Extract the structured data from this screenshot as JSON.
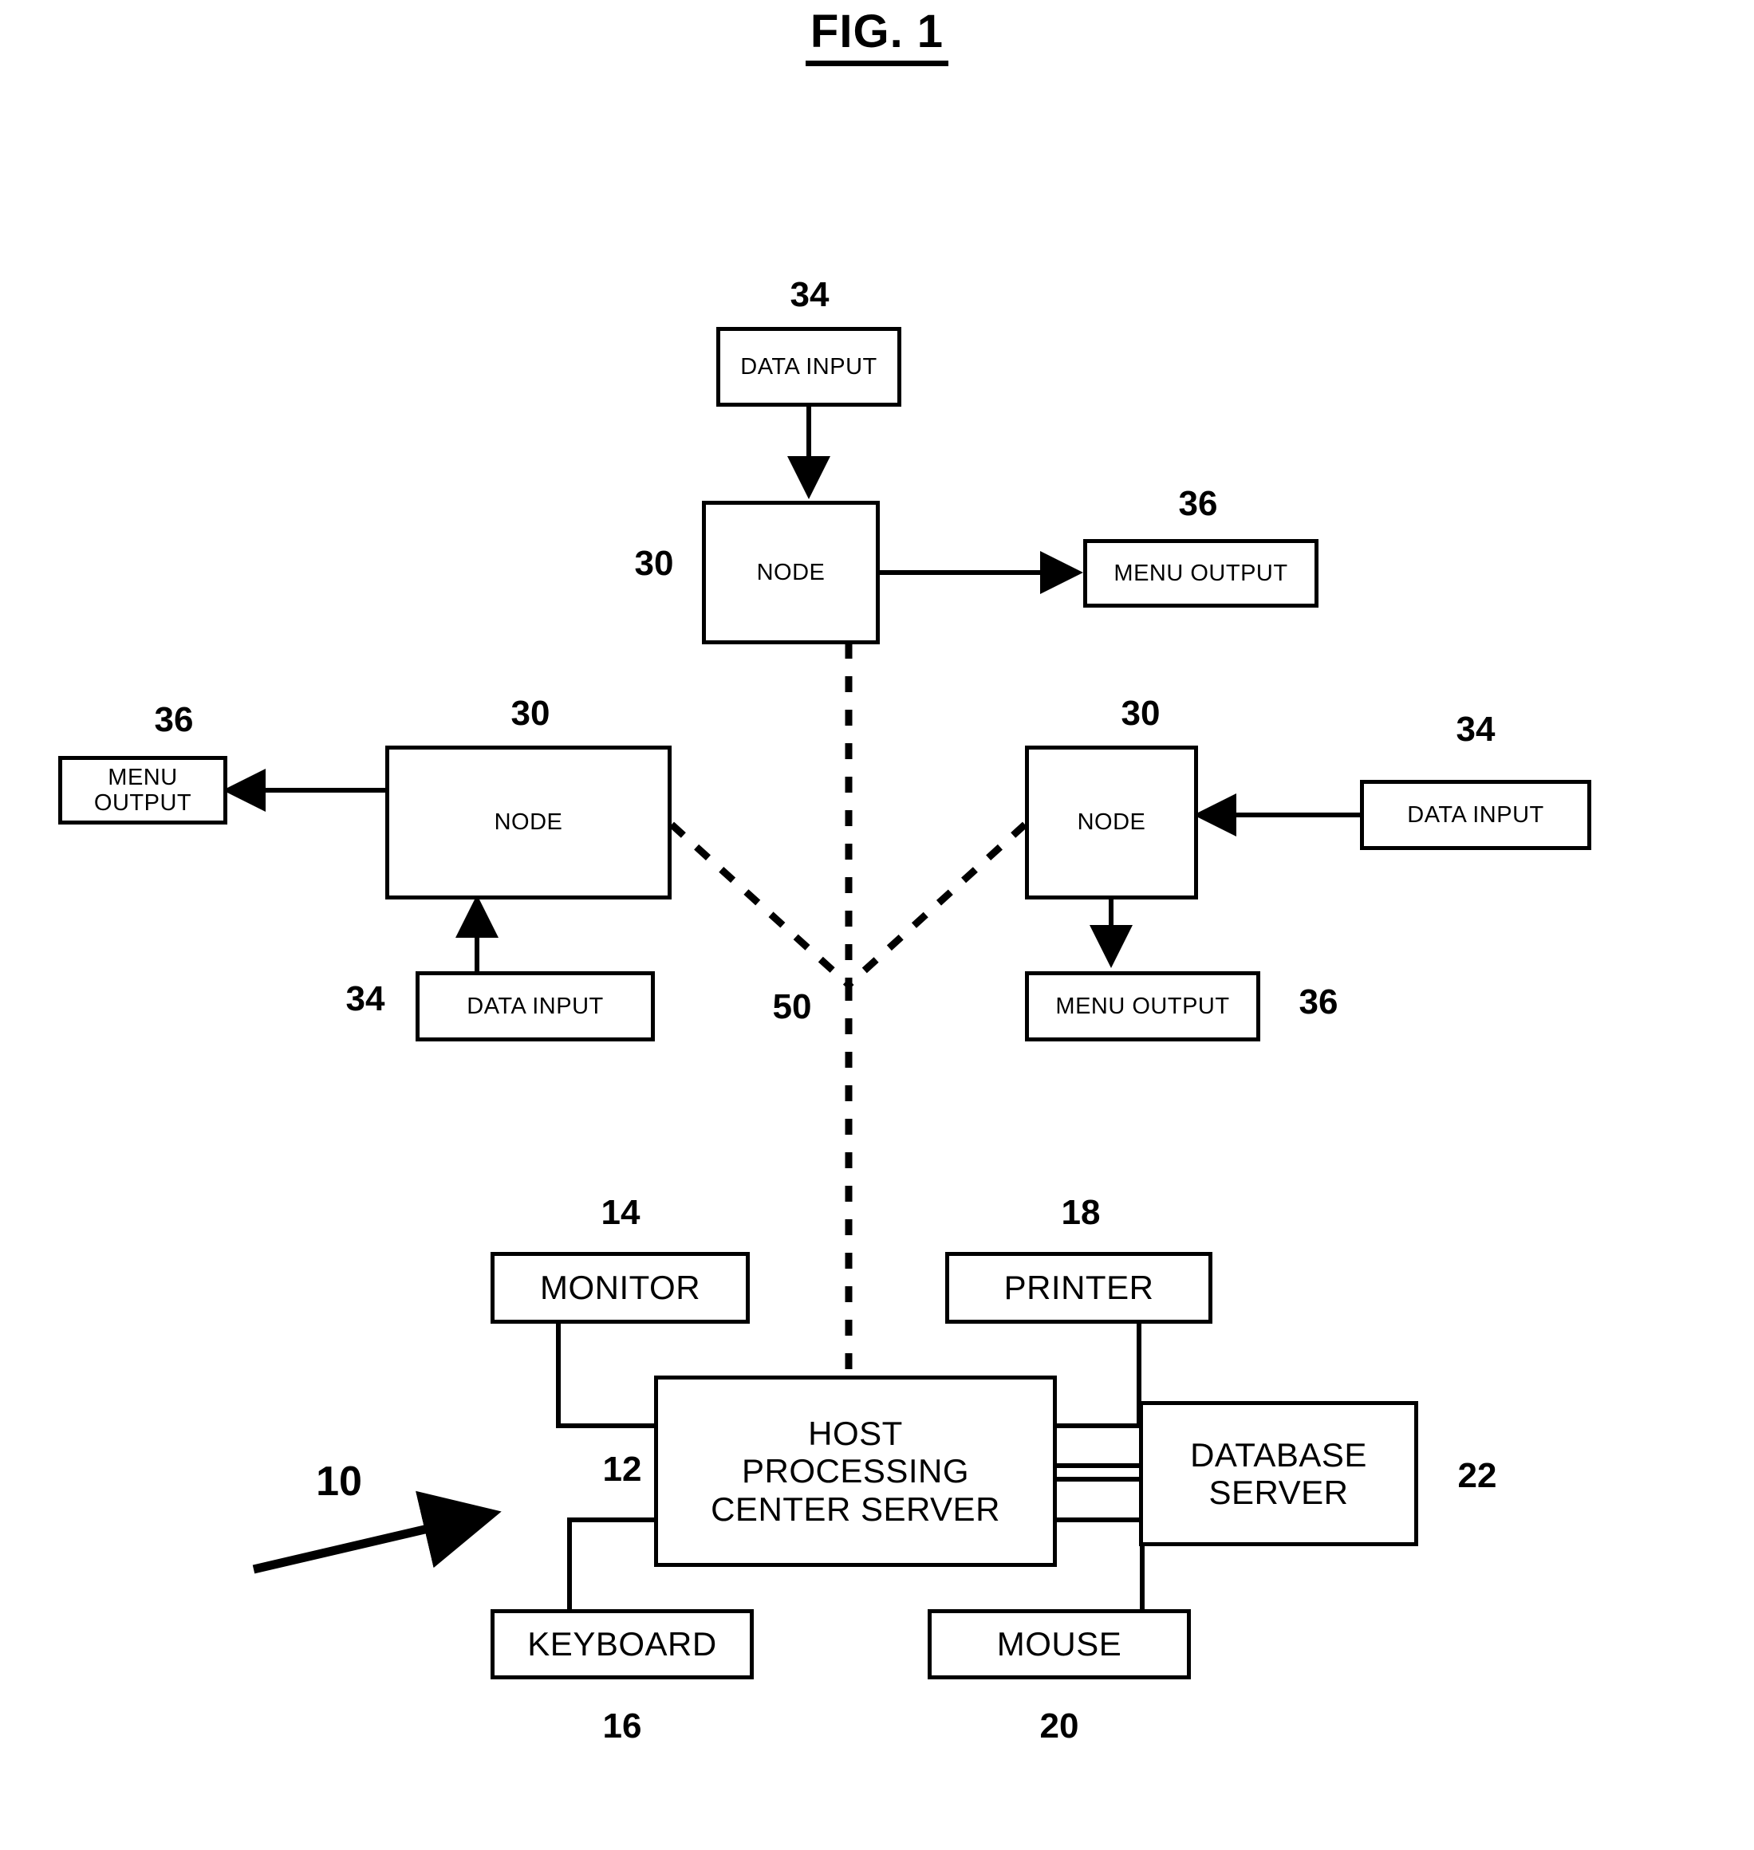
{
  "figure": {
    "title": "FIG. 1",
    "domain_note": "patent block diagram"
  },
  "boxes": {
    "data_input_top": "DATA INPUT",
    "node_top": "NODE",
    "menu_output_top_right": "MENU OUTPUT",
    "menu_output_left": "MENU OUTPUT",
    "node_left": "NODE",
    "node_right": "NODE",
    "data_input_right": "DATA INPUT",
    "data_input_left_lower": "DATA INPUT",
    "menu_output_lower_right": "MENU OUTPUT",
    "monitor": "MONITOR",
    "printer": "PRINTER",
    "host_server_line1": "HOST",
    "host_server_line2": "PROCESSING",
    "host_server_line3": "CENTER SERVER",
    "database_server_line1": "DATABASE",
    "database_server_line2": "SERVER",
    "keyboard": "KEYBOARD",
    "mouse": "MOUSE"
  },
  "reference_numerals": {
    "data_input_top": "34",
    "node_top": "30",
    "menu_output_top_right": "36",
    "menu_output_left": "36",
    "node_left": "30",
    "node_right": "30",
    "data_input_right": "34",
    "data_input_left_lower": "34",
    "menu_output_lower_right": "36",
    "network_junction": "50",
    "system": "10",
    "host_server": "12",
    "monitor": "14",
    "keyboard": "16",
    "printer": "18",
    "mouse": "20",
    "database_server": "22"
  },
  "colors": {
    "stroke": "#000000",
    "background": "#ffffff"
  }
}
